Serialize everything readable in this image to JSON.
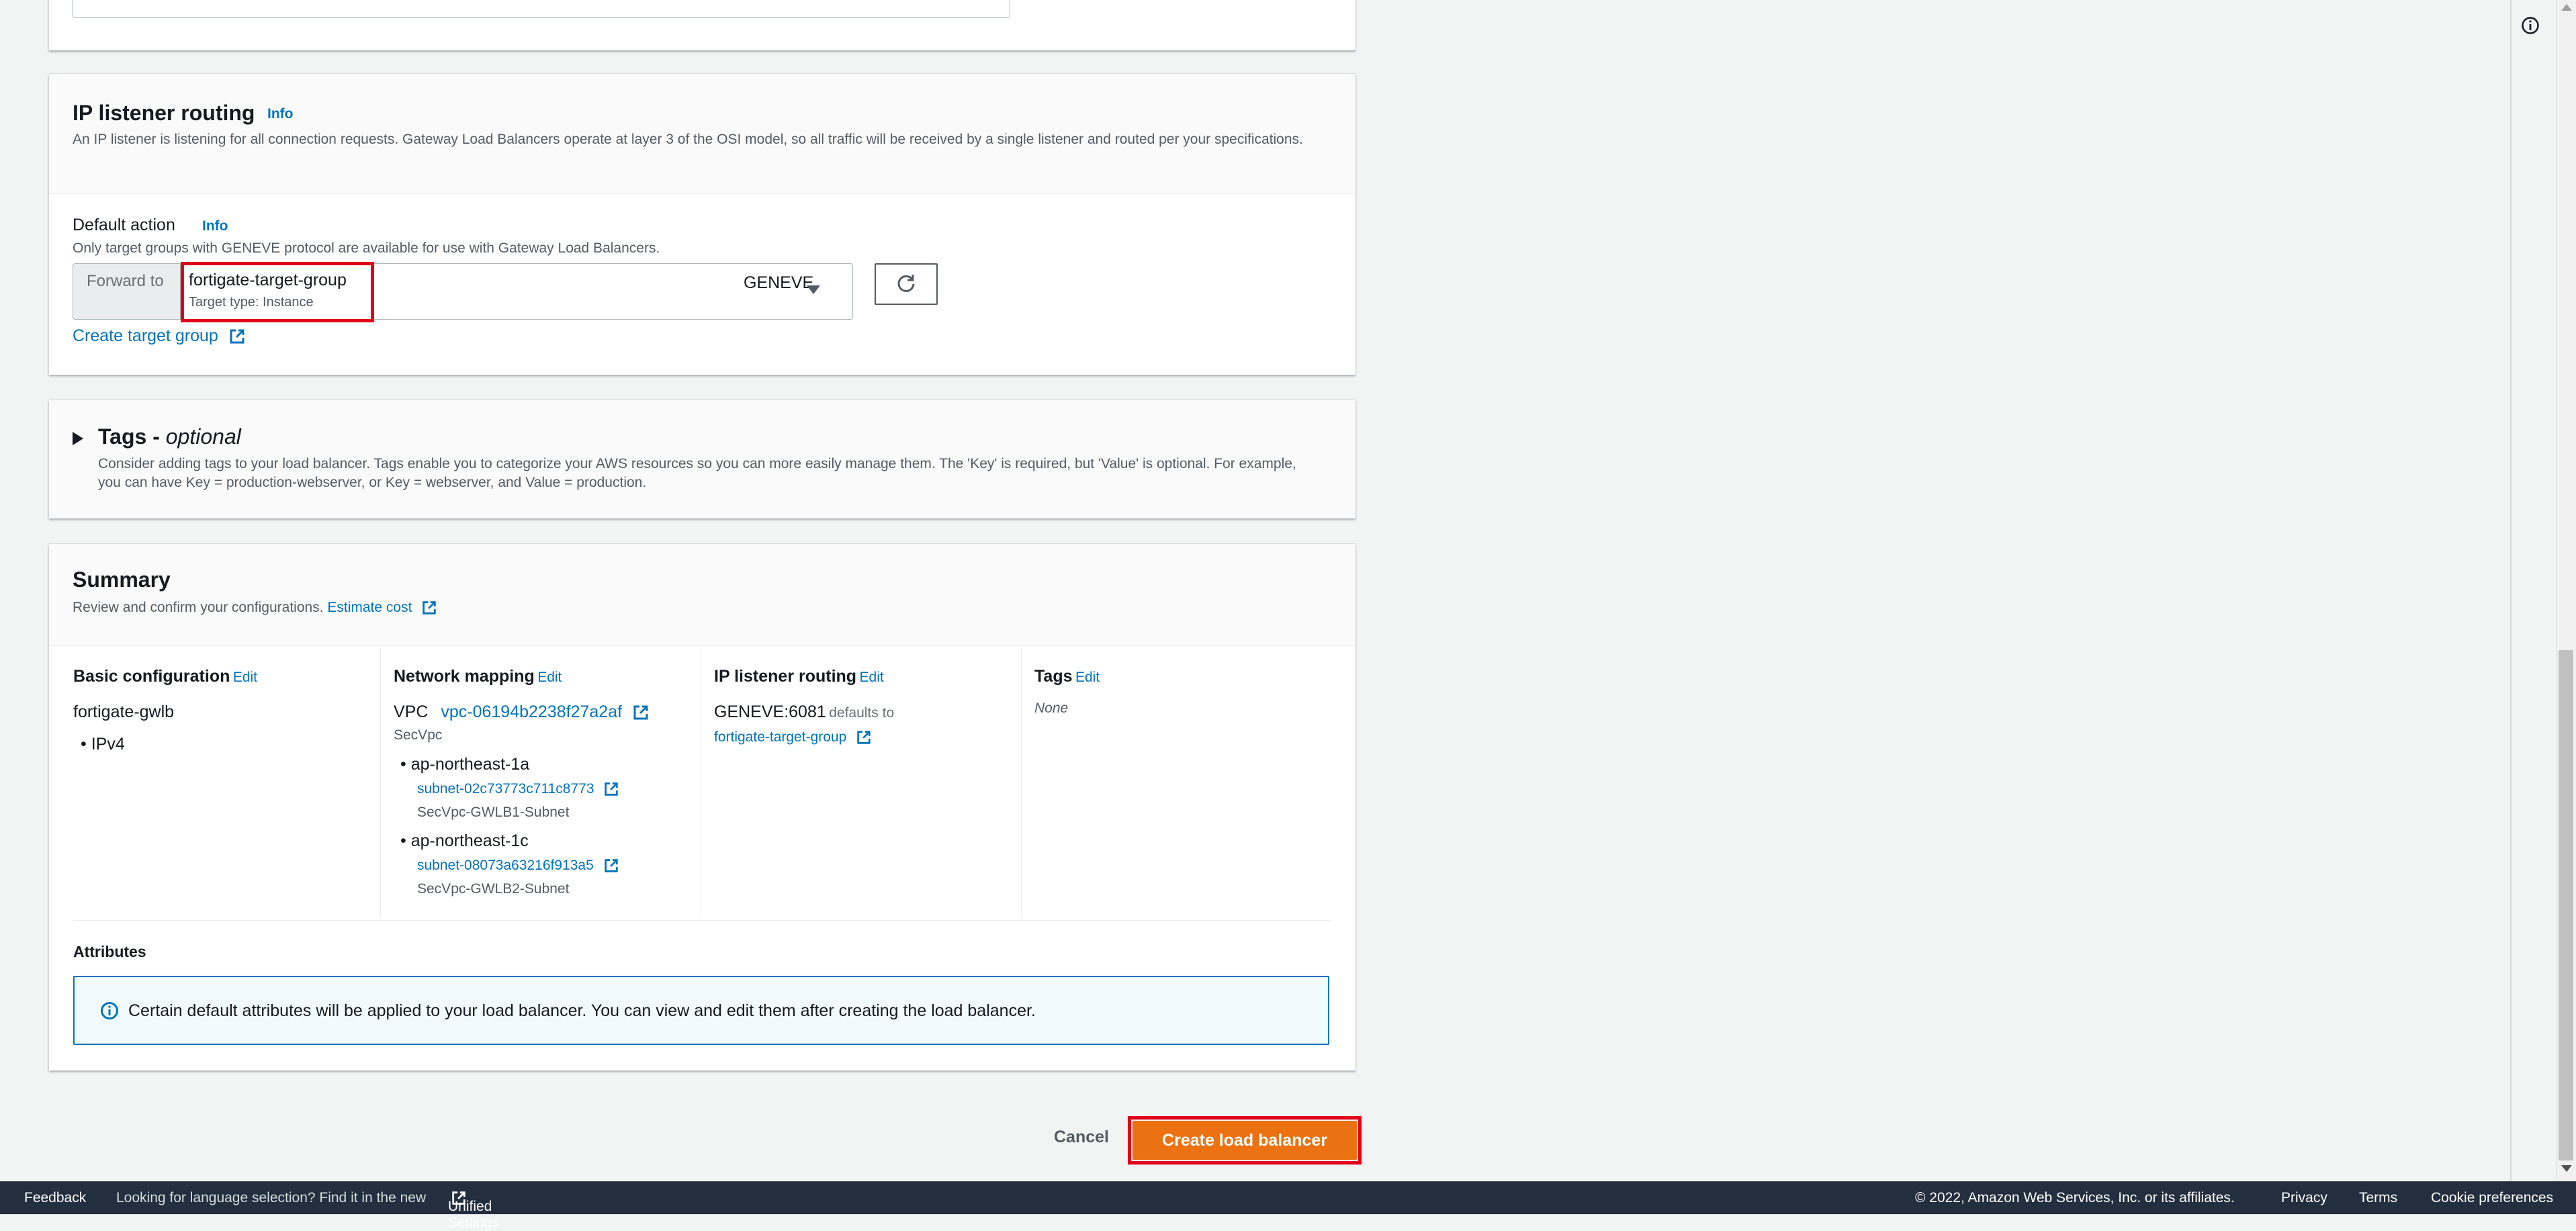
{
  "ip_listener": {
    "title": "IP listener routing",
    "info": "Info",
    "description": "An IP listener is listening for all connection requests. Gateway Load Balancers operate at layer 3 of the OSI model, so all traffic will be received by a single listener and routed per your specifications.",
    "default_action_label": "Default action",
    "default_action_info": "Info",
    "default_action_hint": "Only target groups with GENEVE protocol are available for use with Gateway Load Balancers.",
    "forward_to": "Forward to",
    "selected_target_group": "fortigate-target-group",
    "target_type": "Target type: Instance",
    "protocol": "GENEVE",
    "create_target_group": "Create target group"
  },
  "tags": {
    "title": "Tags - ",
    "optional": "optional",
    "description": "Consider adding tags to your load balancer. Tags enable you to categorize your AWS resources so you can more easily manage them. The 'Key' is required, but 'Value' is optional. For example, you can have Key = production-webserver, or Key = webserver, and Value = production."
  },
  "summary": {
    "title": "Summary",
    "description": "Review and confirm your configurations.",
    "estimate_cost": "Estimate cost",
    "edit": "Edit",
    "basic_configuration": {
      "heading": "Basic configuration",
      "name": "fortigate-gwlb",
      "ip_type": "IPv4"
    },
    "network_mapping": {
      "heading": "Network mapping",
      "vpc_label": "VPC",
      "vpc_id": "vpc-06194b2238f27a2af",
      "vpc_name": "SecVpc",
      "zones": [
        {
          "az": "ap-northeast-1a",
          "subnet": "subnet-02c73773c711c8773",
          "subnet_name": "SecVpc-GWLB1-Subnet"
        },
        {
          "az": "ap-northeast-1c",
          "subnet": "subnet-08073a63216f913a5",
          "subnet_name": "SecVpc-GWLB2-Subnet"
        }
      ]
    },
    "ip_listener_routing": {
      "heading": "IP listener routing",
      "listener": "GENEVE:6081",
      "defaults_to": "defaults to",
      "target_group": "fortigate-target-group"
    },
    "tags": {
      "heading": "Tags",
      "value": "None"
    },
    "attributes": {
      "heading": "Attributes",
      "notice": "Certain default attributes will be applied to your load balancer. You can view and edit them after creating the load balancer."
    }
  },
  "actions": {
    "cancel": "Cancel",
    "create": "Create load balancer"
  },
  "footer": {
    "feedback": "Feedback",
    "language_prompt": "Looking for language selection? Find it in the new",
    "unified_settings": "Unified Settings",
    "copyright": "© 2022, Amazon Web Services, Inc. or its affiliates.",
    "privacy": "Privacy",
    "terms": "Terms",
    "cookie_preferences": "Cookie preferences"
  },
  "colors": {
    "link": "#0073bb",
    "primary_button": "#ec7211",
    "highlight_red": "#e0001a",
    "footer_bg": "#232f3e",
    "info_border": "#0073bb",
    "info_bg": "#f1faff"
  }
}
